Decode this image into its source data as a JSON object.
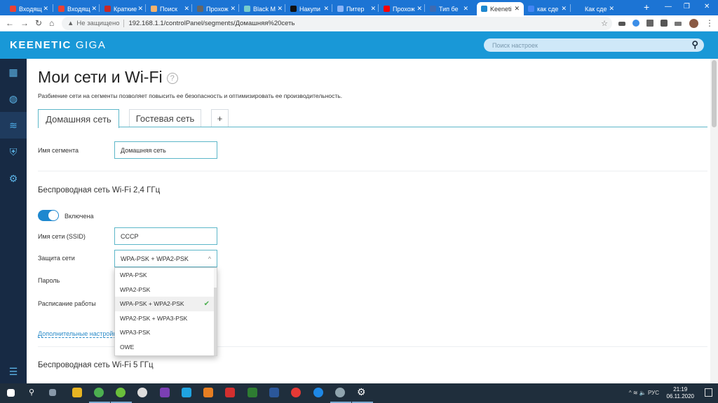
{
  "browser": {
    "tabs": [
      {
        "label": "Входящ",
        "color": "#e94235"
      },
      {
        "label": "Входящ",
        "color": "#e94235"
      },
      {
        "label": "Краткие",
        "color": "#c62828"
      },
      {
        "label": "Поиск",
        "color": "#f6b26b"
      },
      {
        "label": "Прохож",
        "color": "#666"
      },
      {
        "label": "Black M",
        "color": "#7cc"
      },
      {
        "label": "Накупи",
        "color": "#111"
      },
      {
        "label": "Питер",
        "color": "#8ab4f8"
      },
      {
        "label": "Прохож",
        "color": "#ff0000"
      },
      {
        "label": "Тип бе",
        "color": "#3d6bb3"
      },
      {
        "label": "Keeneti",
        "color": "#1e88cf"
      },
      {
        "label": "как сде",
        "color": "#4285f4"
      },
      {
        "label": "Как сде",
        "color": "#1c74d4"
      }
    ],
    "active_tab": 10,
    "new_tab": "+",
    "window_controls": [
      "—",
      "❐",
      "✕"
    ],
    "security_label": "Не защищено",
    "url": "192.168.1.1/controlPanel/segments/Домашняя%20сеть"
  },
  "header": {
    "logo": "KEENETIC",
    "logo_model": "GIGA",
    "search_placeholder": "Поиск настроек"
  },
  "sidebar": {
    "items": [
      "dashboard-icon",
      "globe-icon",
      "wifi-icon",
      "shield-icon",
      "gear-icon"
    ],
    "active": 2,
    "menu": "☰"
  },
  "page": {
    "title": "Мои сети и Wi-Fi",
    "help": "?",
    "subtitle": "Разбиение сети на сегменты позволяет повысить ее безопасность и оптимизировать ее производительность.",
    "tabs": [
      "Домашняя сеть",
      "Гостевая сеть",
      "+"
    ],
    "segment_label": "Имя сегмента",
    "segment_value": "Домашняя сеть",
    "wifi24_heading": "Беспроводная сеть Wi-Fi 2,4 ГГц",
    "toggle_label": "Включена",
    "toggle_on": true,
    "ssid_label": "Имя сети (SSID)",
    "ssid_value": "СССР",
    "security_label": "Защита сети",
    "security_value": "WPA-PSK + WPA2-PSK",
    "password_label": "Пароль",
    "schedule_label": "Расписание работы",
    "advanced_link": "Дополнительные настройки",
    "wifi5_heading": "Беспроводная сеть Wi-Fi 5 ГГц",
    "security_options": [
      "WPA-PSK",
      "WPA2-PSK",
      "WPA-PSK + WPA2-PSK",
      "WPA2-PSK + WPA3-PSK",
      "WPA3-PSK",
      "OWE"
    ],
    "selected_option": 2
  },
  "taskbar": {
    "lang": "РУС",
    "time": "21:19",
    "date": "06.11.2020"
  }
}
